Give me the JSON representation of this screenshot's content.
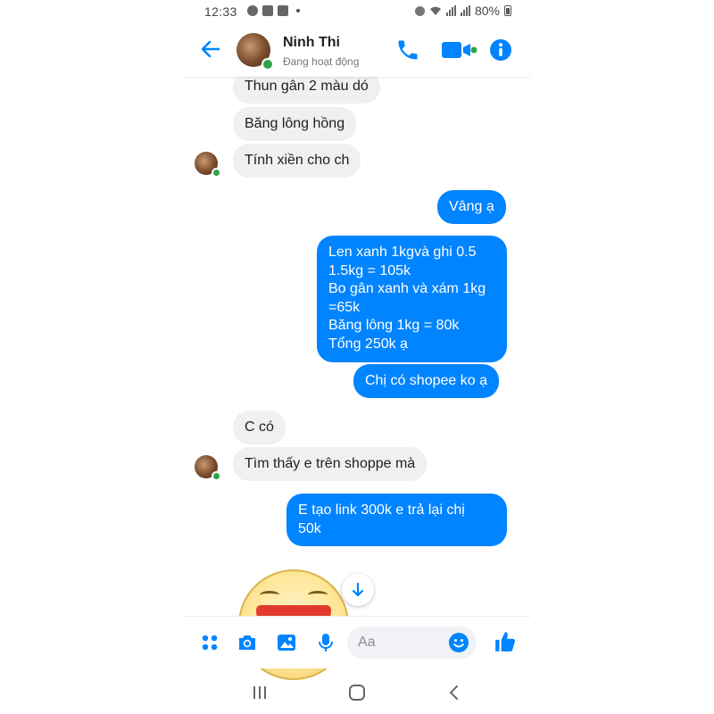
{
  "status_bar": {
    "time": "12:33",
    "battery": "80%"
  },
  "header": {
    "contact_name": "Ninh Thi",
    "status": "Đang hoạt động"
  },
  "messages": [
    {
      "side": "in",
      "text": "Thun gân 2 màu dó"
    },
    {
      "side": "in",
      "text": "Băng lông hồng"
    },
    {
      "side": "in",
      "text": "Tính xiền cho ch"
    },
    {
      "side": "out",
      "text": "Vâng ạ"
    },
    {
      "side": "out",
      "text": "Len xanh 1kgvà ghi 0.5\n1.5kg = 105k\nBo gân xanh và xám 1kg\n=65k\nBăng lông 1kg = 80k\nTổng 250k ạ"
    },
    {
      "side": "out",
      "text": "Chị có shopee ko ạ"
    },
    {
      "side": "in",
      "text": "C có"
    },
    {
      "side": "in",
      "text": "Tìm thấy e trên shoppe mà"
    },
    {
      "side": "out",
      "text": "E tạo link 300k e trả lại chị\n50k"
    }
  ],
  "composer": {
    "placeholder": "Aa"
  },
  "colors": {
    "accent": "#0084ff",
    "incoming_bubble": "#f0f0f0",
    "online": "#31a24c"
  },
  "icons": [
    "back-arrow-icon",
    "phone-icon",
    "video-icon",
    "info-icon",
    "apps-icon",
    "camera-icon",
    "image-icon",
    "microphone-icon",
    "emoji-icon",
    "thumbs-up-icon",
    "arrow-down-icon",
    "recent-apps-icon",
    "home-icon",
    "back-icon"
  ]
}
